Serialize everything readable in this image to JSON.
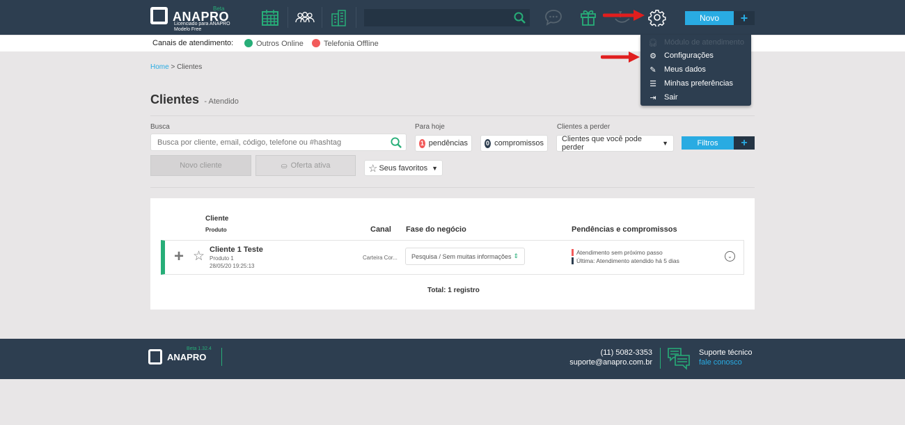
{
  "colors": {
    "header_bg": "#2d3e50",
    "accent_green": "#27ae78",
    "accent_blue": "#29abe2",
    "online": "#27ae78",
    "offline": "#f25b5b",
    "page_bg": "#e8e6e7"
  },
  "header": {
    "logo": {
      "name": "ANAPRO",
      "tag": "Beta",
      "line1": "Licenciado para ANAPRO",
      "line2": "Modelo Free"
    },
    "icons": [
      "calendar-icon",
      "users-icon",
      "buildings-icon",
      "chat-icon",
      "gift-icon",
      "phone-hand-icon",
      "gear-icon"
    ],
    "search": {
      "value": "",
      "placeholder": ""
    },
    "novo_label": "Novo",
    "plus_label": "+"
  },
  "channels": {
    "label": "Canais de atendimento:",
    "items": [
      {
        "label": "Outros Online",
        "status": "online"
      },
      {
        "label": "Telefonia Offline",
        "status": "offline"
      }
    ]
  },
  "user_menu": {
    "items": [
      {
        "label": "Módulo de atendimento",
        "icon": "headset-icon",
        "disabled": true
      },
      {
        "label": "Configurações",
        "icon": "gears-icon"
      },
      {
        "label": "Meus dados",
        "icon": "user-edit-icon"
      },
      {
        "label": "Minhas preferências",
        "icon": "sliders-icon"
      },
      {
        "label": "Sair",
        "icon": "sign-out-icon"
      }
    ]
  },
  "breadcrumb": {
    "home": "Home",
    "sep": " > ",
    "current": "Clientes"
  },
  "page": {
    "title": "Clientes",
    "subtitle": "- Atendido"
  },
  "filters": {
    "busca_label": "Busca",
    "busca_placeholder": "Busca por cliente, email, código, telefone ou #hashtag",
    "busca_value": "",
    "para_hoje_label": "Para hoje",
    "pendencias_count": "1",
    "pendencias_label": "pendências",
    "compromissos_count": "0",
    "compromissos_label": "compromissos",
    "perder_label": "Clientes a perder",
    "perder_value": "Clientes que você pode perder",
    "filtros_label": "Filtros",
    "filtros_plus": "+",
    "novo_cliente": "Novo cliente",
    "oferta_ativa": "Oferta ativa",
    "favoritos": "Seus favoritos"
  },
  "table": {
    "headers": {
      "cliente": "Cliente",
      "produto": "Produto",
      "canal": "Canal",
      "fase": "Fase do negócio",
      "pendencias": "Pendências e compromissos"
    },
    "rows": [
      {
        "name": "Cliente 1 Teste",
        "produto": "Produto 1",
        "date": "28/05/20 19:25:13",
        "canal": "Carteira Cor...",
        "fase": "Pesquisa / Sem muitas informações",
        "pend1": "Atendimento sem próximo passo",
        "pend2": "Última: Atendimento atendido há 5 dias"
      }
    ],
    "total": "Total: 1 registro"
  },
  "footer": {
    "logo": "ANAPRO",
    "version": "Beta 1.32.4",
    "phone": "(11) 5082-3353",
    "email": "suporte@anapro.com.br",
    "support_title": "Suporte técnico",
    "support_link": "fale conosco"
  }
}
